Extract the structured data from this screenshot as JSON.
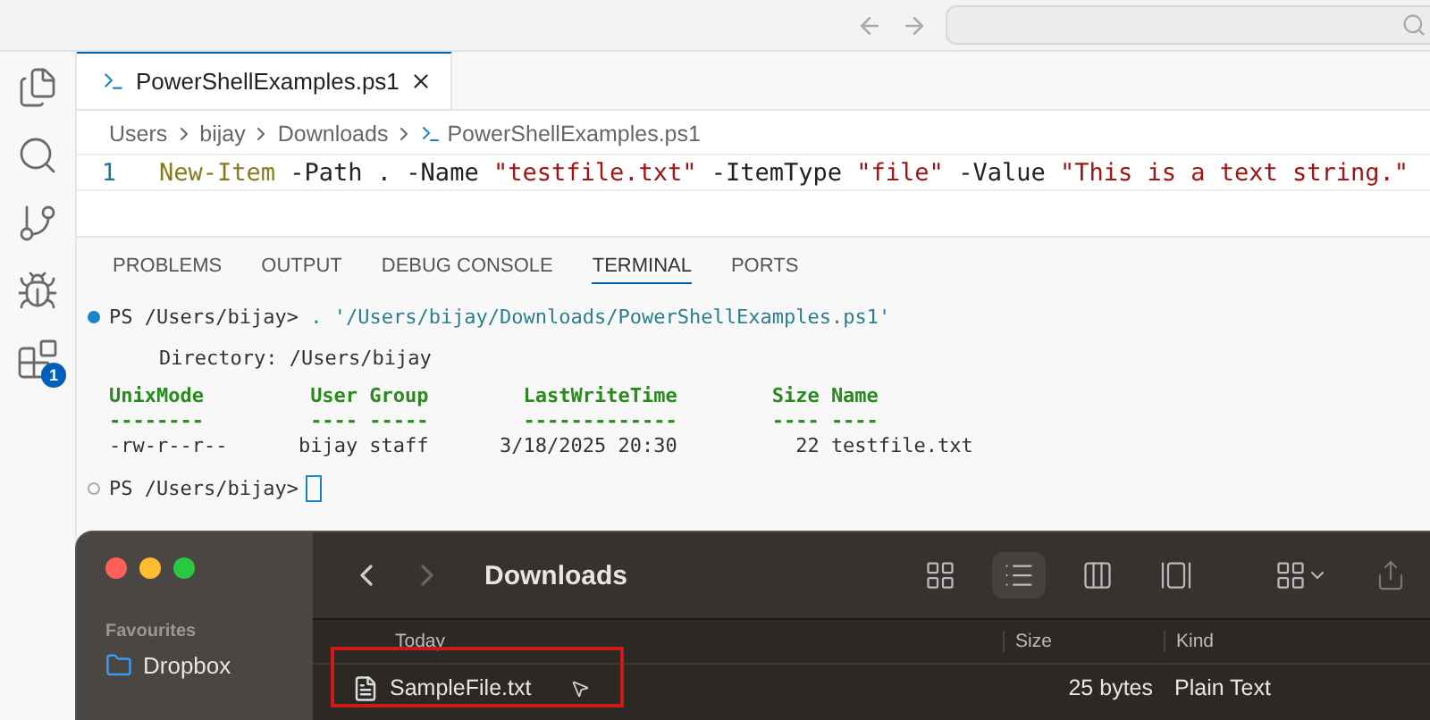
{
  "activity_bar": [
    {
      "kind": "files",
      "selected": false
    },
    {
      "kind": "search",
      "selected": false
    },
    {
      "kind": "source-control",
      "selected": false
    },
    {
      "kind": "run-debug",
      "selected": false
    },
    {
      "kind": "extensions",
      "selected": false,
      "badge": "1"
    }
  ],
  "editor_tabs": [
    {
      "label": "PowerShellExamples.ps1",
      "selected": true
    }
  ],
  "breadcrumb": [
    "Users",
    "bijay",
    "Downloads",
    "PowerShellExamples.ps1"
  ],
  "code": [
    {
      "line_number": "1",
      "tokens": [
        {
          "kind": "command",
          "text": "New-Item"
        },
        {
          "kind": "plain",
          "text": " -Path . -Name "
        },
        {
          "kind": "string",
          "text": "\"testfile.txt\""
        },
        {
          "kind": "plain",
          "text": " -ItemType "
        },
        {
          "kind": "string",
          "text": "\"file\""
        },
        {
          "kind": "plain",
          "text": " -Value "
        },
        {
          "kind": "string",
          "text": "\"This is a text string.\""
        }
      ]
    }
  ],
  "panel_tabs": [
    {
      "label": "PROBLEMS",
      "selected": false
    },
    {
      "label": "OUTPUT",
      "selected": false
    },
    {
      "label": "DEBUG CONSOLE",
      "selected": false
    },
    {
      "label": "TERMINAL",
      "selected": true
    },
    {
      "label": "PORTS",
      "selected": false
    }
  ],
  "terminal": {
    "command": {
      "success": true,
      "prompt": "PS /Users/bijay>",
      "text": ". '/Users/bijay/Downloads/PowerShellExamples.ps1'"
    },
    "directory": "Directory: /Users/bijay",
    "table": {
      "columns": [
        "UnixMode",
        "User",
        "Group",
        "LastWriteTime",
        "Size",
        "Name"
      ],
      "separators": [
        "--------",
        "----",
        "-----",
        "-------------",
        "----",
        "----"
      ],
      "rows": [
        [
          "-rw-r--r--",
          "bijay",
          "staff",
          "3/18/2025 20:30",
          "22",
          "testfile.txt"
        ]
      ]
    },
    "prompt": {
      "success": false,
      "text": "PS /Users/bijay>"
    }
  },
  "finder": {
    "title": "Downloads",
    "sidebar_heading": "Favourites",
    "sidebar_items": [
      {
        "label": "Dropbox",
        "selected": false
      }
    ],
    "view_buttons": [
      {
        "kind": "icons",
        "selected": false
      },
      {
        "kind": "list",
        "selected": true
      },
      {
        "kind": "columns",
        "selected": false
      },
      {
        "kind": "gallery",
        "selected": false
      }
    ],
    "group_label": "Today",
    "columns": [
      "Size",
      "Kind"
    ],
    "files": [
      {
        "name": "SampleFile.txt",
        "size": "25 bytes",
        "kind": "Plain Text",
        "highlighted": true
      }
    ]
  }
}
